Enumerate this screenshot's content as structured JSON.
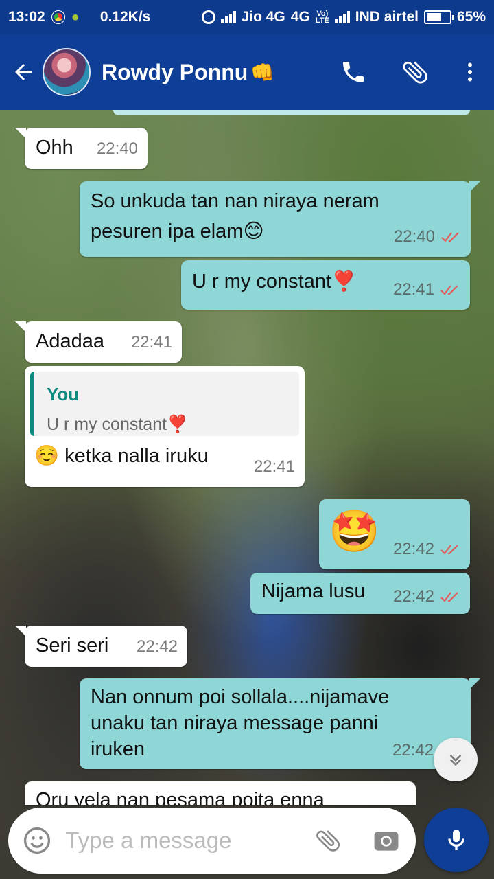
{
  "status_bar": {
    "time": "13:02",
    "net_speed": "0.12K/s",
    "carrier1": "Jio 4G",
    "net1": "4G",
    "volte_top": "Vo)",
    "volte_bottom": "LTE",
    "carrier2": "IND airtel",
    "battery": "65%",
    "battery_level": 0.65
  },
  "header": {
    "contact_name": "Rowdy Ponnu",
    "contact_emoji": "👊",
    "icons": [
      "back-arrow-icon",
      "phone-icon",
      "attachment-icon",
      "more-vert-icon"
    ]
  },
  "messages": [
    {
      "dir": "in",
      "text": "Ohh",
      "time": "22:40"
    },
    {
      "dir": "out",
      "text_line1": "So unkuda tan nan niraya neram",
      "text_line2": "pesuren ipa elam😊",
      "time": "22:40",
      "status": "read"
    },
    {
      "dir": "out",
      "text": "U r my constant❣️",
      "time": "22:41",
      "status": "read"
    },
    {
      "dir": "in",
      "text": "Adadaa",
      "time": "22:41"
    },
    {
      "dir": "in",
      "quote_author": "You",
      "quote_text": "U r my constant❣️",
      "text": "☺️ ketka nalla iruku",
      "time": "22:41"
    },
    {
      "dir": "out",
      "emoji": "🤩",
      "time": "22:42",
      "status": "read"
    },
    {
      "dir": "out",
      "text": "Nijama lusu",
      "time": "22:42",
      "status": "read"
    },
    {
      "dir": "in",
      "text": "Seri seri",
      "time": "22:42"
    },
    {
      "dir": "out",
      "text_line1": "Nan onnum poi sollala....nijamave",
      "text_line2": "unaku tan niraya message panni",
      "text_line3": "iruken",
      "time": "22:42",
      "status": "read"
    },
    {
      "dir": "in",
      "text": "Oru vela nan pesama poita enna"
    }
  ],
  "composer": {
    "placeholder": "Type a message"
  },
  "colors": {
    "header_bg": "#0f3e96",
    "outgoing_bubble": "#8fd6d6",
    "incoming_bubble": "#ffffff",
    "read_tick": "#e35b5b",
    "quote_accent": "#0e8a7e"
  }
}
